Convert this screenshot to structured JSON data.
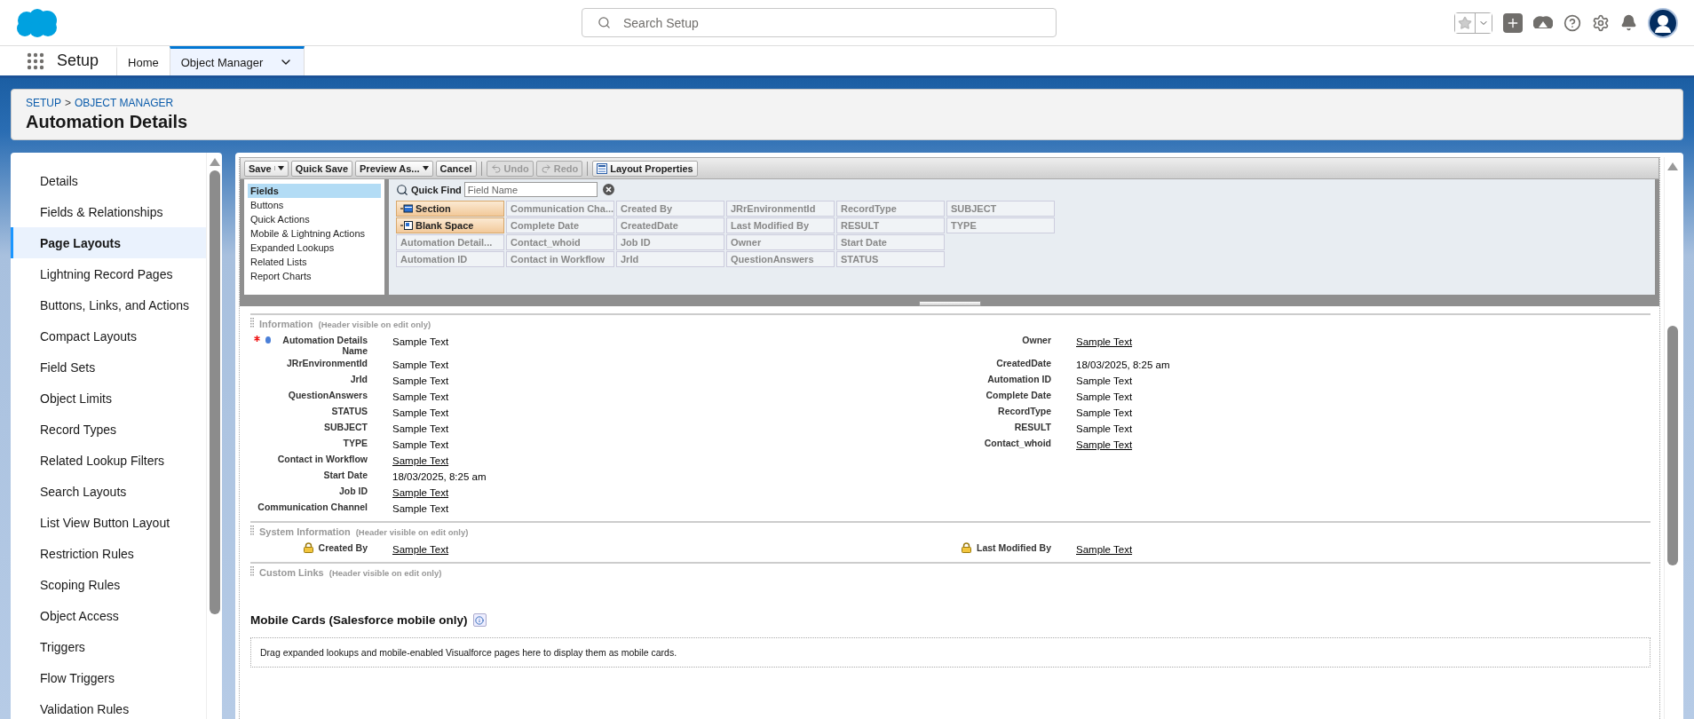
{
  "header": {
    "search_placeholder": "Search Setup"
  },
  "nav": {
    "app_name": "Setup",
    "tabs": [
      {
        "label": "Home",
        "selected": false,
        "dropdown": false
      },
      {
        "label": "Object Manager",
        "selected": true,
        "dropdown": true
      }
    ]
  },
  "page_header": {
    "breadcrumb": [
      "SETUP",
      "OBJECT MANAGER"
    ],
    "separator": ">",
    "title": "Automation Details"
  },
  "sidebar": {
    "items": [
      {
        "label": "Details",
        "selected": false
      },
      {
        "label": "Fields & Relationships",
        "selected": false
      },
      {
        "label": "Page Layouts",
        "selected": true
      },
      {
        "label": "Lightning Record Pages",
        "selected": false
      },
      {
        "label": "Buttons, Links, and Actions",
        "selected": false
      },
      {
        "label": "Compact Layouts",
        "selected": false
      },
      {
        "label": "Field Sets",
        "selected": false
      },
      {
        "label": "Object Limits",
        "selected": false
      },
      {
        "label": "Record Types",
        "selected": false
      },
      {
        "label": "Related Lookup Filters",
        "selected": false
      },
      {
        "label": "Search Layouts",
        "selected": false
      },
      {
        "label": "List View Button Layout",
        "selected": false
      },
      {
        "label": "Restriction Rules",
        "selected": false
      },
      {
        "label": "Scoping Rules",
        "selected": false
      },
      {
        "label": "Object Access",
        "selected": false
      },
      {
        "label": "Triggers",
        "selected": false
      },
      {
        "label": "Flow Triggers",
        "selected": false
      },
      {
        "label": "Validation Rules",
        "selected": false
      }
    ]
  },
  "toolbar": {
    "buttons": [
      {
        "label": "Save",
        "kind": "split",
        "disabled": false
      },
      {
        "label": "Quick Save",
        "kind": "plain",
        "disabled": false
      },
      {
        "label": "Preview As...",
        "kind": "dropdown",
        "disabled": false
      },
      {
        "label": "Cancel",
        "kind": "plain",
        "disabled": false
      },
      {
        "label": "Undo",
        "kind": "undo",
        "disabled": true
      },
      {
        "label": "Redo",
        "kind": "redo",
        "disabled": true
      },
      {
        "label": "Layout Properties",
        "kind": "properties",
        "disabled": false
      }
    ]
  },
  "palette": {
    "categories": [
      {
        "label": "Fields",
        "selected": true
      },
      {
        "label": "Buttons",
        "selected": false
      },
      {
        "label": "Quick Actions",
        "selected": false
      },
      {
        "label": "Mobile & Lightning Actions",
        "selected": false
      },
      {
        "label": "Expanded Lookups",
        "selected": false
      },
      {
        "label": "Related Lists",
        "selected": false
      },
      {
        "label": "Report Charts",
        "selected": false
      }
    ],
    "quick_find": {
      "label": "Quick Find",
      "placeholder": "Field Name"
    },
    "rows": [
      [
        {
          "label": "Section",
          "kind": "section"
        },
        {
          "label": "Communication Cha...",
          "kind": "field"
        },
        {
          "label": "Created By",
          "kind": "field"
        },
        {
          "label": "JRrEnvironmentId",
          "kind": "field"
        },
        {
          "label": "RecordType",
          "kind": "field"
        },
        {
          "label": "SUBJECT",
          "kind": "field"
        }
      ],
      [
        {
          "label": "Blank Space",
          "kind": "blank"
        },
        {
          "label": "Complete Date",
          "kind": "field"
        },
        {
          "label": "CreatedDate",
          "kind": "field"
        },
        {
          "label": "Last Modified By",
          "kind": "field"
        },
        {
          "label": "RESULT",
          "kind": "field"
        },
        {
          "label": "TYPE",
          "kind": "field"
        }
      ],
      [
        {
          "label": "Automation Detail...",
          "kind": "field"
        },
        {
          "label": "Contact_whoid",
          "kind": "field"
        },
        {
          "label": "Job ID",
          "kind": "field"
        },
        {
          "label": "Owner",
          "kind": "field"
        },
        {
          "label": "Start Date",
          "kind": "field"
        }
      ],
      [
        {
          "label": "Automation ID",
          "kind": "field"
        },
        {
          "label": "Contact in Workflow",
          "kind": "field"
        },
        {
          "label": "JrId",
          "kind": "field"
        },
        {
          "label": "QuestionAnswers",
          "kind": "field"
        },
        {
          "label": "STATUS",
          "kind": "field"
        }
      ]
    ]
  },
  "layout_sections": [
    {
      "title": "Information",
      "note": "(Header visible on edit only)",
      "left_fields": [
        {
          "label": "Automation Details Name",
          "value": "Sample Text",
          "link": false,
          "required": true,
          "locked": false
        },
        {
          "label": "JRrEnvironmentId",
          "value": "Sample Text",
          "link": false,
          "required": false,
          "locked": false
        },
        {
          "label": "JrId",
          "value": "Sample Text",
          "link": false,
          "required": false,
          "locked": false
        },
        {
          "label": "QuestionAnswers",
          "value": "Sample Text",
          "link": false,
          "required": false,
          "locked": false
        },
        {
          "label": "STATUS",
          "value": "Sample Text",
          "link": false,
          "required": false,
          "locked": false
        },
        {
          "label": "SUBJECT",
          "value": "Sample Text",
          "link": false,
          "required": false,
          "locked": false
        },
        {
          "label": "TYPE",
          "value": "Sample Text",
          "link": false,
          "required": false,
          "locked": false
        },
        {
          "label": "Contact in Workflow",
          "value": "Sample Text",
          "link": true,
          "required": false,
          "locked": false
        },
        {
          "label": "Start Date",
          "value": "18/03/2025, 8:25 am",
          "link": false,
          "required": false,
          "locked": false
        },
        {
          "label": "Job ID",
          "value": "Sample Text",
          "link": true,
          "required": false,
          "locked": false
        },
        {
          "label": "Communication Channel",
          "value": "Sample Text",
          "link": false,
          "required": false,
          "locked": false
        }
      ],
      "right_fields": [
        {
          "label": "Owner",
          "value": "Sample Text",
          "link": true,
          "required": false,
          "locked": false
        },
        {
          "label": "CreatedDate",
          "value": "18/03/2025, 8:25 am",
          "link": false,
          "required": false,
          "locked": false
        },
        {
          "label": "Automation ID",
          "value": "Sample Text",
          "link": false,
          "required": false,
          "locked": false
        },
        {
          "label": "Complete Date",
          "value": "Sample Text",
          "link": false,
          "required": false,
          "locked": false
        },
        {
          "label": "RecordType",
          "value": "Sample Text",
          "link": false,
          "required": false,
          "locked": false
        },
        {
          "label": "RESULT",
          "value": "Sample Text",
          "link": false,
          "required": false,
          "locked": false
        },
        {
          "label": "Contact_whoid",
          "value": "Sample Text",
          "link": true,
          "required": false,
          "locked": false
        }
      ]
    },
    {
      "title": "System Information",
      "note": "(Header visible on edit only)",
      "left_fields": [
        {
          "label": "Created By",
          "value": "Sample Text",
          "link": true,
          "required": false,
          "locked": true
        }
      ],
      "right_fields": [
        {
          "label": "Last Modified By",
          "value": "Sample Text",
          "link": true,
          "required": false,
          "locked": true
        }
      ]
    },
    {
      "title": "Custom Links",
      "note": "(Header visible on edit only)"
    }
  ],
  "mobile_cards": {
    "title": "Mobile Cards (Salesforce mobile only)",
    "hint": "Drag expanded lookups and mobile-enabled Visualforce pages here to display them as mobile cards."
  }
}
